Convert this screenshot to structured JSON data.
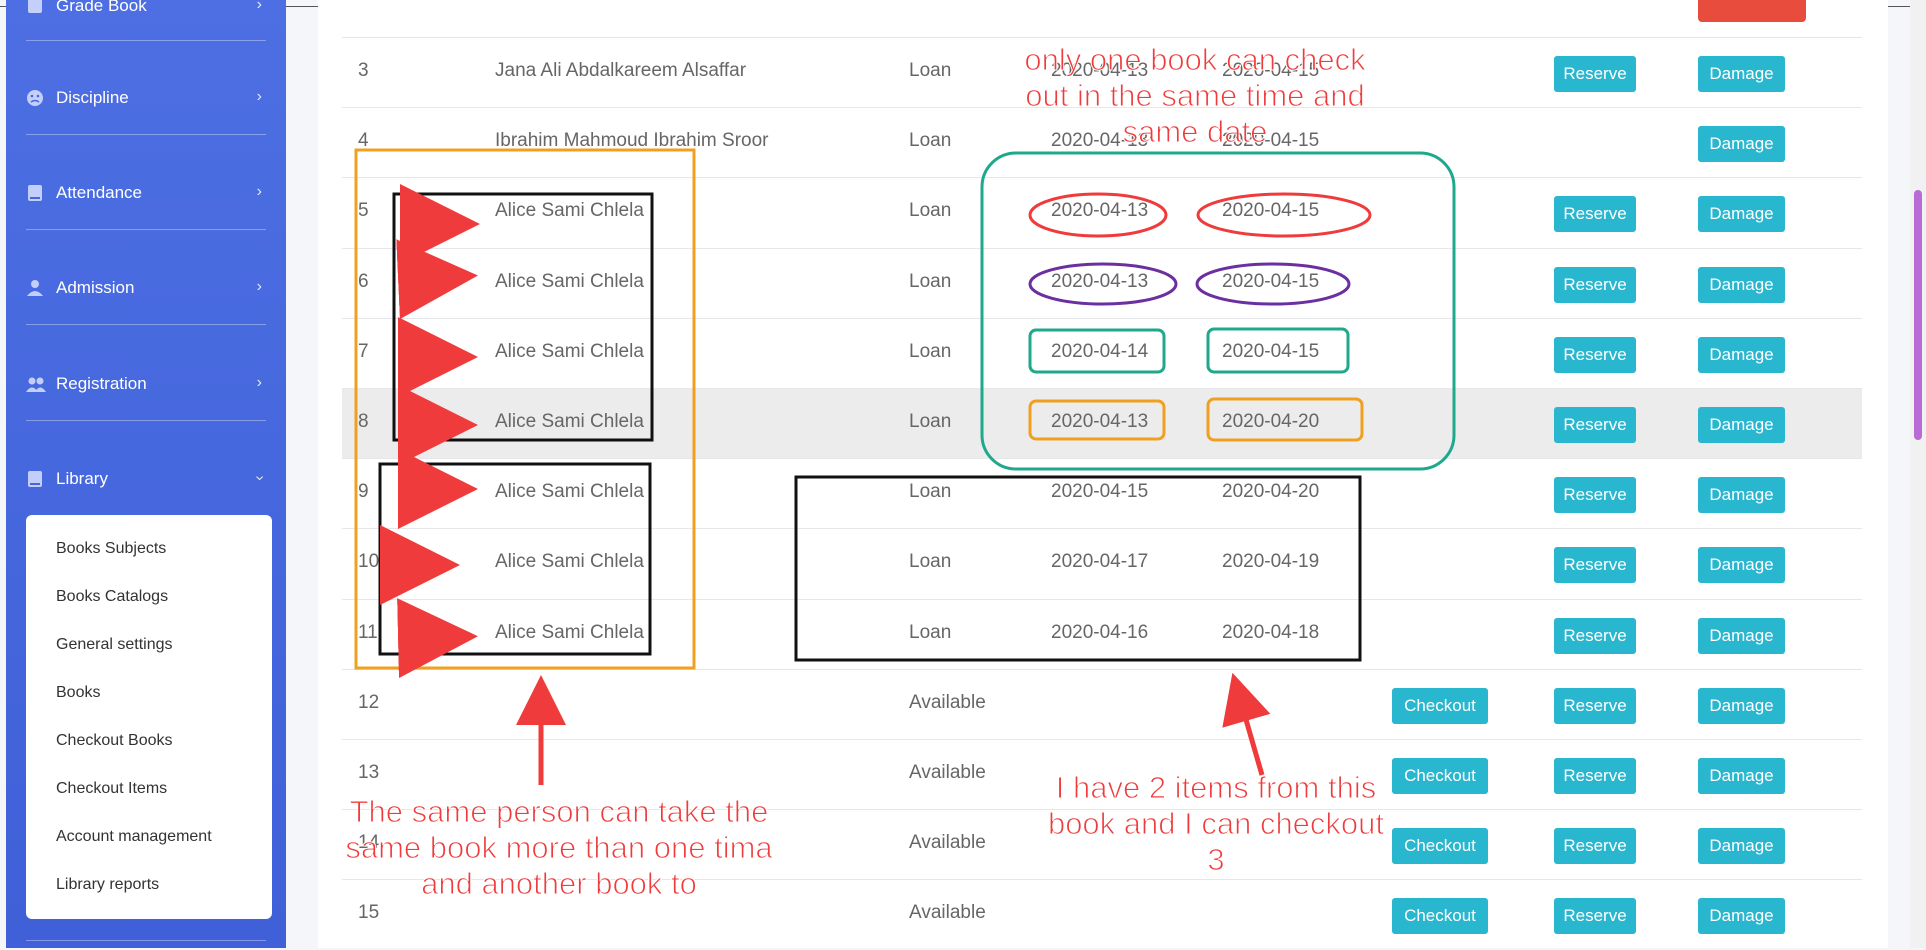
{
  "sidebar": {
    "top_item": "Grade Book",
    "items": [
      {
        "label": "Discipline",
        "icon": "frown-icon"
      },
      {
        "label": "Attendance",
        "icon": "book-icon"
      },
      {
        "label": "Admission",
        "icon": "user-icon"
      },
      {
        "label": "Registration",
        "icon": "users-icon"
      },
      {
        "label": "Library",
        "icon": "book-icon"
      }
    ],
    "library_submenu": [
      "Books Subjects",
      "Books Catalogs",
      "General settings",
      "Books",
      "Checkout Books",
      "Checkout Items",
      "Account management",
      "Library reports"
    ]
  },
  "table": {
    "buttons": {
      "checkout": "Checkout",
      "reserve": "Reserve",
      "damage": "Damage"
    },
    "rows": [
      {
        "no": "3",
        "name": "Jana Ali Abdalkareem Alsaffar",
        "status": "Loan",
        "from": "2020-04-13",
        "to": "2020-04-15"
      },
      {
        "no": "4",
        "name": "Ibrahim Mahmoud Ibrahim Sroor",
        "status": "Loan",
        "from": "2020-04-13",
        "to": "2020-04-15"
      },
      {
        "no": "5",
        "name": "Alice Sami Chlela",
        "status": "Loan",
        "from": "2020-04-13",
        "to": "2020-04-15"
      },
      {
        "no": "6",
        "name": "Alice Sami Chlela",
        "status": "Loan",
        "from": "2020-04-13",
        "to": "2020-04-15"
      },
      {
        "no": "7",
        "name": "Alice Sami Chlela",
        "status": "Loan",
        "from": "2020-04-14",
        "to": "2020-04-15"
      },
      {
        "no": "8",
        "name": "Alice Sami Chlela",
        "status": "Loan",
        "from": "2020-04-13",
        "to": "2020-04-20"
      },
      {
        "no": "9",
        "name": "Alice Sami Chlela",
        "status": "Loan",
        "from": "2020-04-15",
        "to": "2020-04-20"
      },
      {
        "no": "10",
        "name": "Alice Sami Chlela",
        "status": "Loan",
        "from": "2020-04-17",
        "to": "2020-04-19"
      },
      {
        "no": "11",
        "name": "Alice Sami Chlela",
        "status": "Loan",
        "from": "2020-04-16",
        "to": "2020-04-18"
      },
      {
        "no": "12",
        "name": "",
        "status": "Available",
        "from": "",
        "to": ""
      },
      {
        "no": "13",
        "name": "",
        "status": "Available",
        "from": "",
        "to": ""
      },
      {
        "no": "14",
        "name": "",
        "status": "Available",
        "from": "",
        "to": ""
      },
      {
        "no": "15",
        "name": "",
        "status": "Available",
        "from": "",
        "to": ""
      }
    ]
  },
  "annotations": {
    "top": "only one book can check out in the same time and same date",
    "bottom_left": "The same person can take the same book more than one tima and another book to",
    "bottom_right": "I have 2 items from this book and I can checkout 3"
  },
  "colors": {
    "sidebar": "#4466e0",
    "button": "#29b6cf",
    "annotation_red": "#ef3b3b",
    "annotation_orange": "#f0a020",
    "annotation_teal": "#1fa98c",
    "annotation_purple": "#6b2fa0"
  }
}
